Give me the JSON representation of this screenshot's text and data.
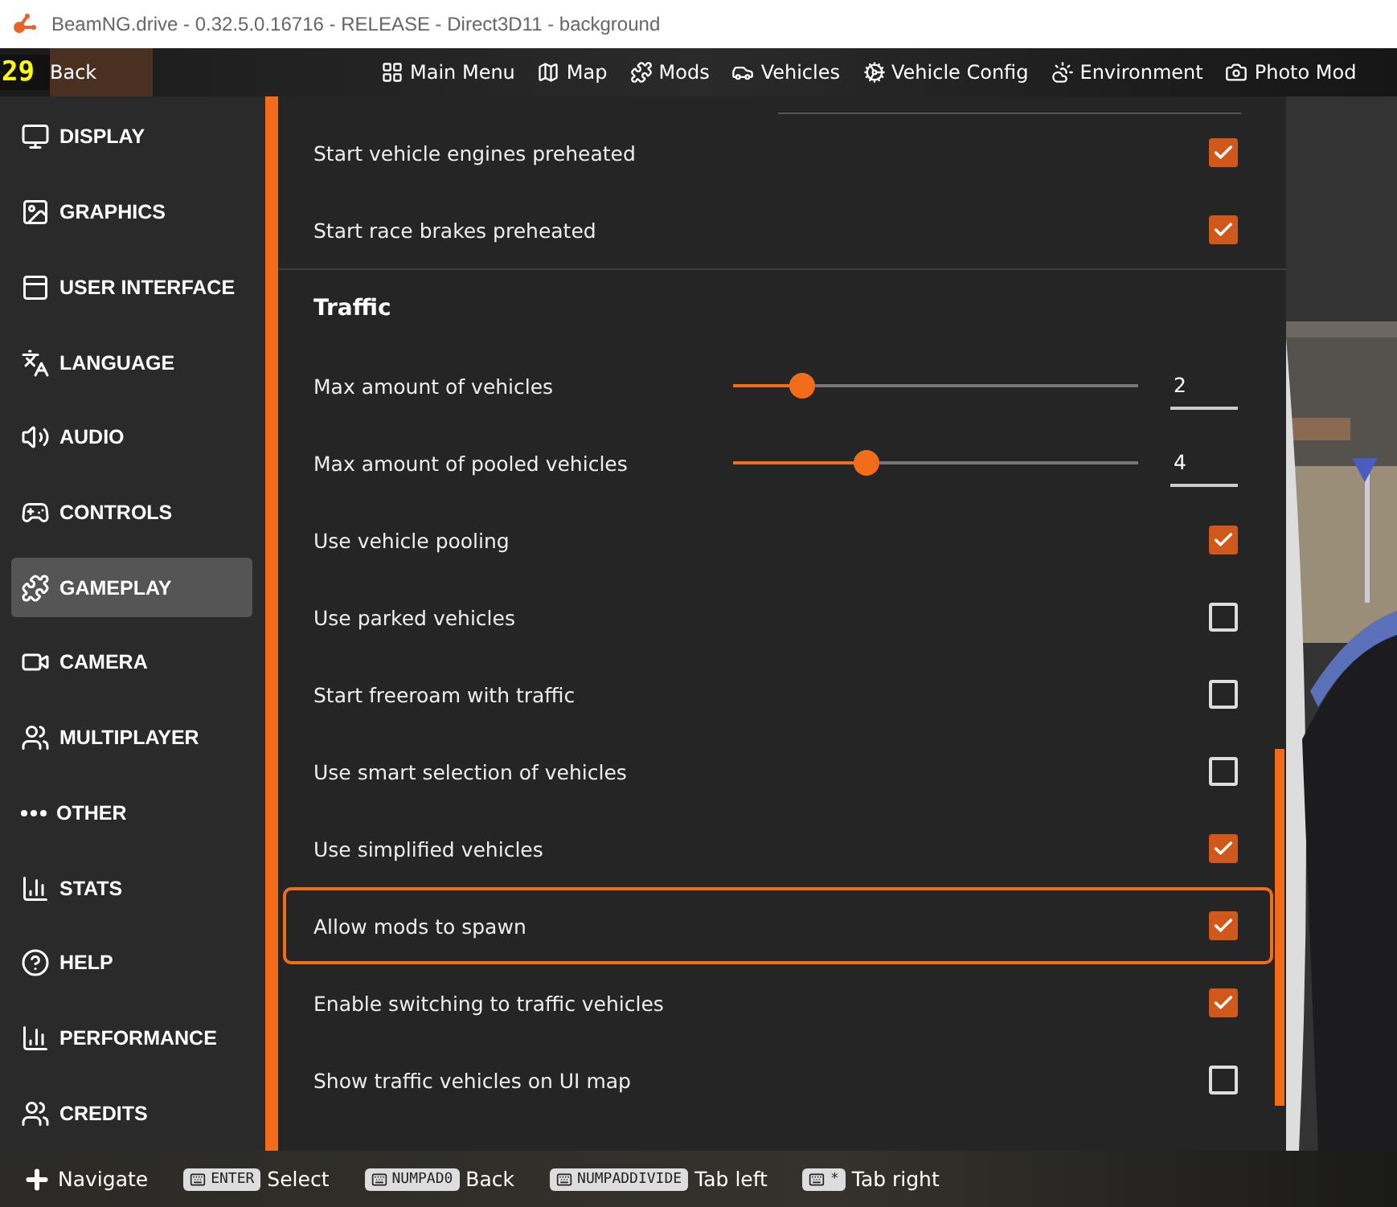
{
  "window": {
    "title": "BeamNG.drive - 0.32.5.0.16716 - RELEASE - Direct3D11 - background"
  },
  "fps": "29",
  "back": "Back",
  "menu": [
    {
      "label": "Main Menu"
    },
    {
      "label": "Map"
    },
    {
      "label": "Mods"
    },
    {
      "label": "Vehicles"
    },
    {
      "label": "Vehicle Config"
    },
    {
      "label": "Environment"
    },
    {
      "label": "Photo Mod"
    }
  ],
  "sidebar": {
    "items": [
      {
        "label": "DISPLAY",
        "selected": false
      },
      {
        "label": "GRAPHICS",
        "selected": false
      },
      {
        "label": "USER INTERFACE",
        "selected": false
      },
      {
        "label": "LANGUAGE",
        "selected": false
      },
      {
        "label": "AUDIO",
        "selected": false
      },
      {
        "label": "CONTROLS",
        "selected": false
      },
      {
        "label": "GAMEPLAY",
        "selected": true
      },
      {
        "label": "CAMERA",
        "selected": false
      },
      {
        "label": "MULTIPLAYER",
        "selected": false
      },
      {
        "label": "OTHER",
        "selected": false
      },
      {
        "label": "STATS",
        "selected": false
      },
      {
        "label": "HELP",
        "selected": false
      },
      {
        "label": "PERFORMANCE",
        "selected": false
      },
      {
        "label": "CREDITS",
        "selected": false
      }
    ]
  },
  "settings": [
    {
      "kind": "checkbox",
      "label": "Start vehicle engines preheated",
      "checked": true,
      "focused": false
    },
    {
      "kind": "checkbox",
      "label": "Start race brakes preheated",
      "checked": true,
      "focused": false
    },
    {
      "kind": "heading",
      "label": "Traffic"
    },
    {
      "kind": "slider",
      "label": "Max amount of vehicles",
      "level": 0.17,
      "value": "2"
    },
    {
      "kind": "slider",
      "label": "Max amount of pooled vehicles",
      "level": 0.33,
      "value": "4"
    },
    {
      "kind": "checkbox",
      "label": "Use vehicle pooling",
      "checked": true,
      "focused": false
    },
    {
      "kind": "checkbox",
      "label": "Use parked vehicles",
      "checked": false,
      "focused": false
    },
    {
      "kind": "checkbox",
      "label": "Start freeroam with traffic",
      "checked": false,
      "focused": false
    },
    {
      "kind": "checkbox",
      "label": "Use smart selection of vehicles",
      "checked": false,
      "focused": false
    },
    {
      "kind": "checkbox",
      "label": "Use simplified vehicles",
      "checked": true,
      "focused": false
    },
    {
      "kind": "checkbox",
      "label": "Allow mods to spawn",
      "checked": true,
      "focused": true
    },
    {
      "kind": "checkbox",
      "label": "Enable switching to traffic vehicles",
      "checked": true,
      "focused": false
    },
    {
      "kind": "checkbox",
      "label": "Show traffic vehicles on UI map",
      "checked": false,
      "focused": false
    }
  ],
  "hints": [
    {
      "label": "Navigate",
      "kind": "dpad"
    },
    {
      "key": "ENTER",
      "label": "Select",
      "kind": "key"
    },
    {
      "key": "NUMPAD0",
      "label": "Back",
      "kind": "key"
    },
    {
      "key": "NUMPADDIVIDE",
      "label": "Tab left",
      "kind": "key"
    },
    {
      "key": "*",
      "label": "Tab right",
      "kind": "key"
    }
  ]
}
